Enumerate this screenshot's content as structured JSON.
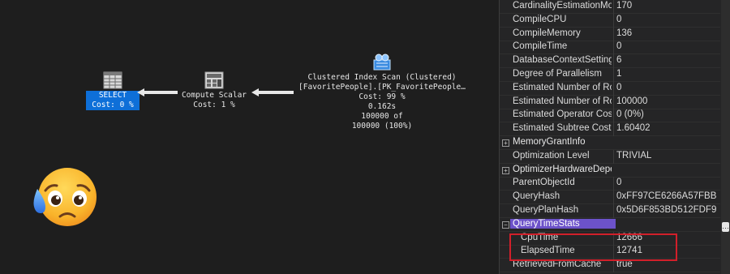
{
  "plan": {
    "select": {
      "title": "SELECT",
      "cost": "Cost: 0 %"
    },
    "compute_scalar": {
      "title": "Compute Scalar",
      "cost": "Cost: 1 %"
    },
    "index_scan": {
      "title": "Clustered Index Scan (Clustered)",
      "object": "[FavoritePeople].[PK_FavoritePeople…",
      "cost": "Cost: 99 %",
      "time": "0.162s",
      "rows": "100000 of",
      "rows_pct": "100000 (100%)"
    }
  },
  "properties": [
    {
      "name": "CardinalityEstimationMoc",
      "value": "170",
      "type": "row"
    },
    {
      "name": "CompileCPU",
      "value": "0",
      "type": "row"
    },
    {
      "name": "CompileMemory",
      "value": "136",
      "type": "row"
    },
    {
      "name": "CompileTime",
      "value": "0",
      "type": "row"
    },
    {
      "name": "DatabaseContextSettingsl",
      "value": "6",
      "type": "row"
    },
    {
      "name": "Degree of Parallelism",
      "value": "1",
      "type": "row"
    },
    {
      "name": "Estimated Number of Row",
      "value": "0",
      "type": "row"
    },
    {
      "name": "Estimated Number of Row",
      "value": "100000",
      "type": "row"
    },
    {
      "name": "Estimated Operator Cost",
      "value": "0 (0%)",
      "type": "row"
    },
    {
      "name": "Estimated Subtree Cost",
      "value": "1.60402",
      "type": "row"
    },
    {
      "name": "MemoryGrantInfo",
      "value": "",
      "type": "group"
    },
    {
      "name": "Optimization Level",
      "value": "TRIVIAL",
      "type": "row"
    },
    {
      "name": "OptimizerHardwareDeper",
      "value": "",
      "type": "group"
    },
    {
      "name": "ParentObjectId",
      "value": "0",
      "type": "row"
    },
    {
      "name": "QueryHash",
      "value": "0xFF97CE6266A57FBB",
      "type": "row"
    },
    {
      "name": "QueryPlanHash",
      "value": "0x5D6F853BD512FDF9",
      "type": "row"
    },
    {
      "name": "QueryTimeStats",
      "value": "",
      "type": "group-open"
    },
    {
      "name": "CpuTime",
      "value": "12666",
      "type": "sub"
    },
    {
      "name": "ElapsedTime",
      "value": "12741",
      "type": "sub"
    },
    {
      "name": "RetrievedFromCache",
      "value": "true",
      "type": "row"
    }
  ],
  "expander": {
    "collapsed": "+",
    "expanded": "−"
  },
  "scroll_btn": "…",
  "colors": {
    "accent": "#6c52c9",
    "select_blue": "#0e6fd8",
    "highlight_red": "#d21f2a"
  }
}
